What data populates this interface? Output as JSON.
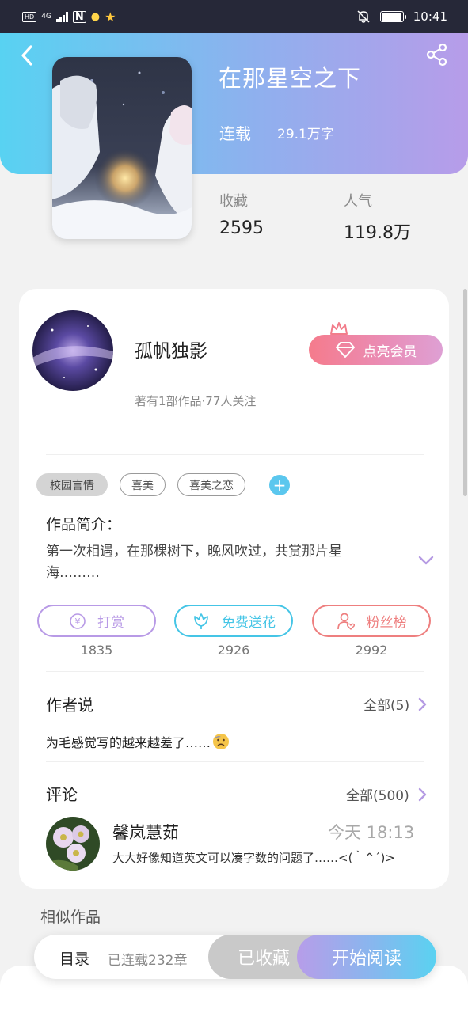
{
  "status_bar": {
    "left_chips": [
      "HD",
      "4G"
    ],
    "time": "10:41",
    "icons": [
      "nfc-icon",
      "bulb-icon",
      "star-icon",
      "mute-bell-icon",
      "battery-icon"
    ]
  },
  "book": {
    "title": "在那星空之下",
    "status": "连载",
    "word_count": "29.1万字",
    "stats": [
      {
        "label": "收藏",
        "value": "2595"
      },
      {
        "label": "人气",
        "value": "119.8万"
      }
    ]
  },
  "author": {
    "name": "孤帆独影",
    "subtitle": "著有1部作品·77人关注",
    "vip_button": "点亮会员"
  },
  "tags": [
    "校园言情",
    "喜美",
    "喜美之恋"
  ],
  "intro": {
    "heading": "作品简介：",
    "text": "第一次相遇，在那棵树下，晚风吹过，共赏那片星海………"
  },
  "actions": [
    {
      "label": "打赏",
      "count": "1835",
      "icon": "coin-icon",
      "color": "#b89ae6"
    },
    {
      "label": "免费送花",
      "count": "2926",
      "icon": "flower-icon",
      "color": "#45c5e6"
    },
    {
      "label": "粉丝榜",
      "count": "2992",
      "icon": "fan-heart-icon",
      "color": "#ee7f7f"
    }
  ],
  "author_says": {
    "heading": "作者说",
    "more": "全部(5)",
    "text": "为毛感觉写的越来越差了……"
  },
  "comments": {
    "heading": "评论",
    "more": "全部(500)",
    "items": [
      {
        "name": "馨岚慧茹",
        "time": "今天 18:13",
        "text": "大大好像知道英文可以凑字数的问题了……<(｀^´)>"
      }
    ]
  },
  "similar": {
    "heading": "相似作品"
  },
  "bottom_bar": {
    "toc": "目录",
    "chapters": "已连载232章",
    "collected": "已收藏",
    "read": "开始阅读"
  },
  "colors": {
    "hero_start": "#58d2f2",
    "hero_end": "#b79ce9",
    "vip": "#f57b8c"
  }
}
